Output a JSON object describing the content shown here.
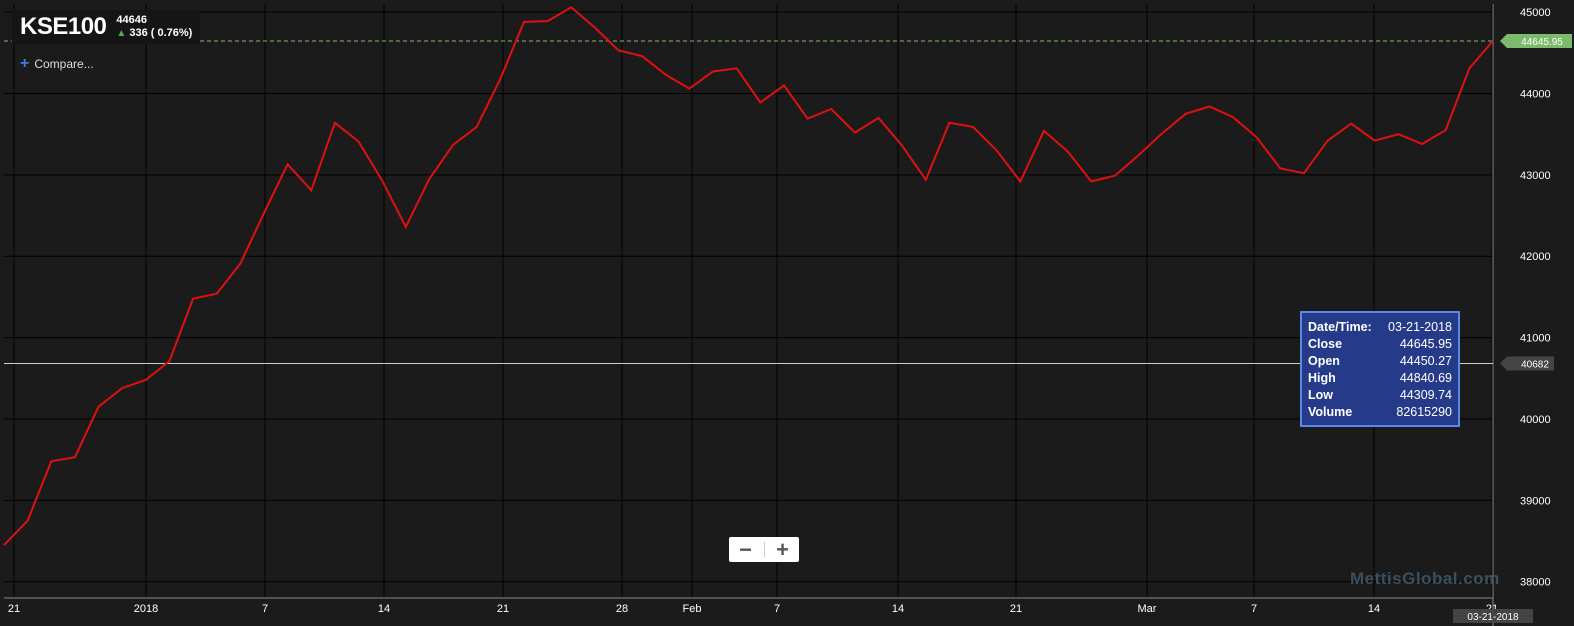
{
  "header": {
    "symbol": "KSE100",
    "last": "44646",
    "change": "336 ( 0.76%)",
    "compare_label": "Compare..."
  },
  "colors": {
    "line": "#e01010",
    "background": "#1b1b1b",
    "grid": "#000000",
    "last_price_badge": "#7dbb6c",
    "crosshair_badge": "#444444"
  },
  "chart_data": {
    "type": "line",
    "ylim": [
      37800,
      45100
    ],
    "yticks": [
      38000,
      39000,
      40000,
      41000,
      42000,
      43000,
      44000,
      45000
    ],
    "xticks": [
      "21",
      "2018",
      "7",
      "14",
      "21",
      "28",
      "Feb",
      "7",
      "14",
      "21",
      "Mar",
      "7",
      "14",
      "21"
    ],
    "series": [
      {
        "values": [
          38450,
          38750,
          39480,
          39530,
          40150,
          40380,
          40480,
          40710,
          41480,
          41540,
          41910,
          42530,
          43130,
          42810,
          43640,
          43410,
          42930,
          42360,
          42950,
          43370,
          43590,
          44180,
          44880,
          44890,
          45060,
          44810,
          44530,
          44460,
          44230,
          44060,
          44270,
          44310,
          43890,
          44100,
          43690,
          43810,
          43520,
          43700,
          43360,
          42940,
          43640,
          43590,
          43300,
          42920,
          43540,
          43290,
          42920,
          42990,
          43240,
          43510,
          43750,
          43840,
          43710,
          43460,
          43080,
          43020,
          43420,
          43630,
          43420,
          43500,
          43380,
          43550,
          44310,
          44646
        ]
      }
    ],
    "last_price_label": "44645.95",
    "crosshair_value_label": "40682",
    "crosshair_date_label": "03-21-2018"
  },
  "tooltip": {
    "rows": [
      {
        "label": "Date/Time:",
        "value": "03-21-2018"
      },
      {
        "label": "Close",
        "value": "44645.95"
      },
      {
        "label": "Open",
        "value": "44450.27"
      },
      {
        "label": "High",
        "value": "44840.69"
      },
      {
        "label": "Low",
        "value": "44309.74"
      },
      {
        "label": "Volume",
        "value": "82615290"
      }
    ]
  },
  "zoom": {
    "minus": "−",
    "plus": "+"
  },
  "watermark": "MettisGlobal.com"
}
